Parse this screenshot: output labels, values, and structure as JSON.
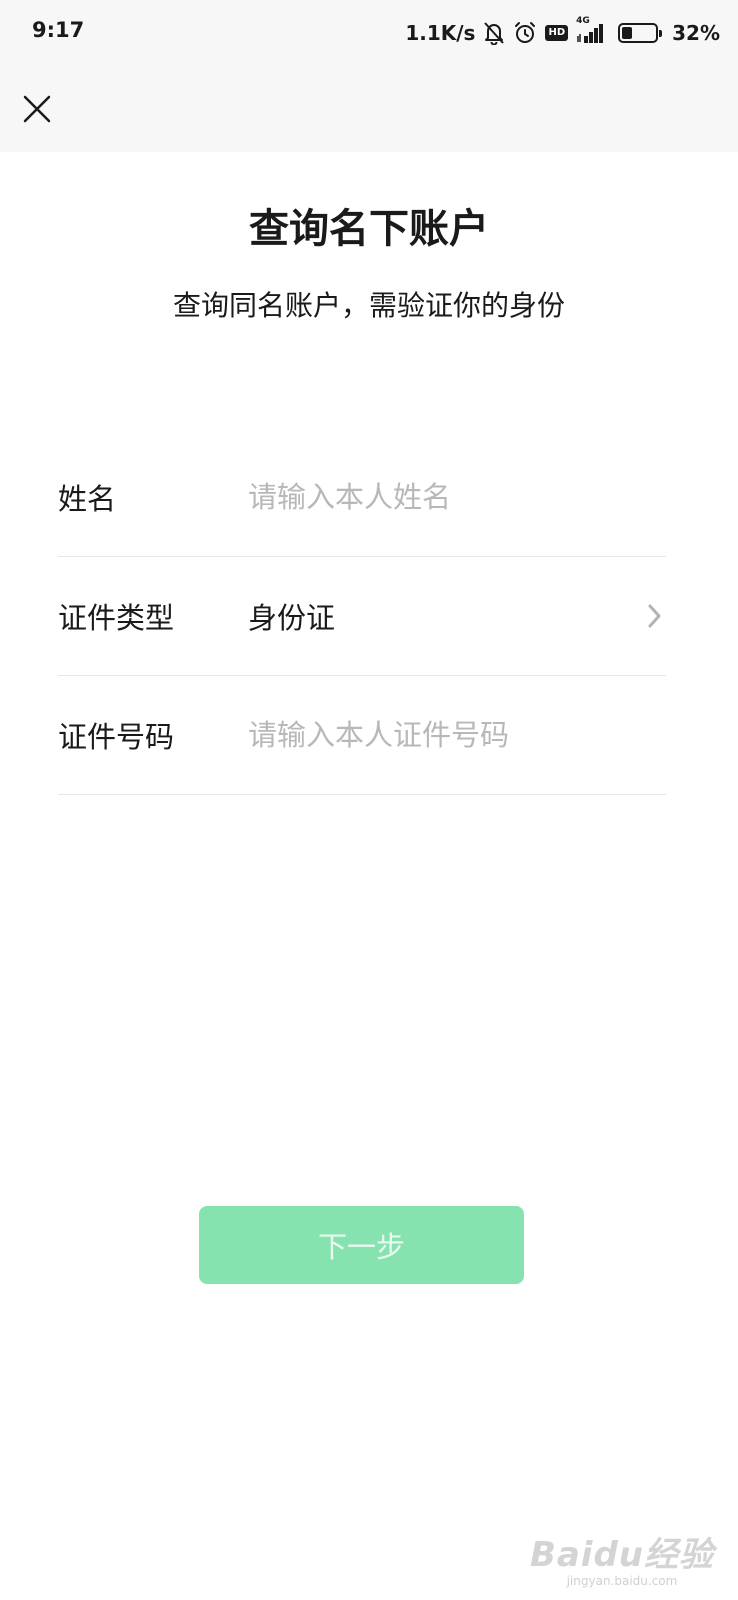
{
  "status_bar": {
    "time": "9:17",
    "network_speed": "1.1K/s",
    "network_type": "4G",
    "hd_label": "HD",
    "battery_percent": "32%",
    "battery_level": 0.32,
    "icons": [
      "bell-off-icon",
      "alarm-icon",
      "hd-icon",
      "signal-icon",
      "battery-icon"
    ]
  },
  "nav": {
    "close_icon": "close-icon"
  },
  "page": {
    "title": "查询名下账户",
    "subtitle": "查询同名账户，需验证你的身份"
  },
  "form": {
    "name": {
      "label": "姓名",
      "value": "",
      "placeholder": "请输入本人姓名"
    },
    "id_type": {
      "label": "证件类型",
      "value": "身份证",
      "icon": "chevron-right-icon"
    },
    "id_number": {
      "label": "证件号码",
      "value": "",
      "placeholder": "请输入本人证件号码"
    }
  },
  "actions": {
    "next_label": "下一步",
    "next_color": "#86e3b0"
  },
  "watermark": {
    "logo": "Baidu经验",
    "sub": "jingyan.baidu.com"
  }
}
